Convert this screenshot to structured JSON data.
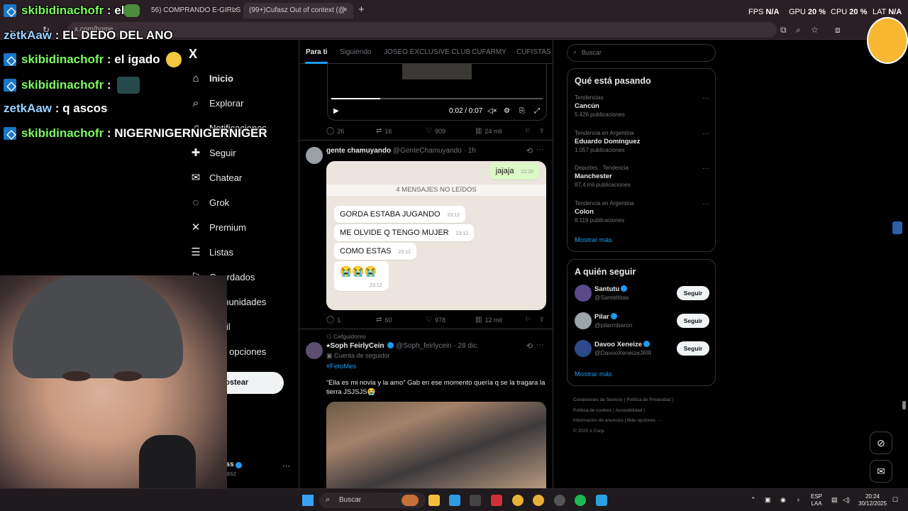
{
  "browser": {
    "tabs": [
      {
        "title": "56) COMPRANDO E-GIRLS",
        "close": "×"
      },
      {
        "title": "(99+)Cufasz Out of context (@",
        "close": "×"
      }
    ],
    "new_tab": "+",
    "url": "x.com/home",
    "perf": {
      "fps_label": "FPS",
      "fps_value": "N/A",
      "gpu_label": "GPU",
      "gpu_value": "20 %",
      "cpu_label": "CPU",
      "cpu_value": "20 %",
      "lat_label": "LAT",
      "lat_value": "N/A"
    }
  },
  "stream_chat": [
    {
      "user": "skibidinachofr",
      "color": "green",
      "text": ": el",
      "badge": true
    },
    {
      "user": "zetkAaw",
      "color": "blue",
      "text": ": EL DEDO DEL ANO",
      "badge": false
    },
    {
      "user": "skibidinachofr",
      "color": "green",
      "text": ": el igado",
      "badge": true
    },
    {
      "user": "skibidinachofr",
      "color": "green",
      "text": ":",
      "badge": true
    },
    {
      "user": "zetkAaw",
      "color": "blue",
      "text": ": q ascos",
      "badge": false
    },
    {
      "user": "skibidinachofr",
      "color": "green",
      "text": ": NIGERNIGERNIGERNIGER",
      "badge": true
    }
  ],
  "sidebar": {
    "logo": "X",
    "items": [
      {
        "label": "Inicio",
        "icon": "home-icon",
        "glyph": "⌂"
      },
      {
        "label": "Explorar",
        "icon": "search-icon",
        "glyph": "⌕"
      },
      {
        "label": "Notificaciones",
        "icon": "bell-icon",
        "glyph": "♫"
      },
      {
        "label": "Seguir",
        "icon": "follow-icon",
        "glyph": "✚"
      },
      {
        "label": "Chatear",
        "icon": "mail-icon",
        "glyph": "✉"
      },
      {
        "label": "Grok",
        "icon": "grok-icon",
        "glyph": "◌"
      },
      {
        "label": "Premium",
        "icon": "x-premium-icon",
        "glyph": "✕"
      },
      {
        "label": "Listas",
        "icon": "list-icon",
        "glyph": "☰"
      },
      {
        "label": "Guardados",
        "icon": "bookmark-icon",
        "glyph": "⚐"
      },
      {
        "label": "Comunidades",
        "icon": "communities-icon",
        "glyph": "⚇"
      },
      {
        "label": "Perfil",
        "icon": "profile-icon",
        "glyph": "⚲"
      },
      {
        "label": "Más opciones",
        "icon": "more-options-icon",
        "glyph": "⋯"
      }
    ],
    "post_button": "Postear",
    "account": {
      "name": "cufass",
      "handle": "@cufasz",
      "more": "···"
    }
  },
  "feed": {
    "tabs": [
      "Para ti",
      "Siguiendo",
      "JOSEO EXCLUSIVE CLUB",
      "CUFARMY",
      "CUFISTAS"
    ],
    "video": {
      "time": "0:02 / 0:07",
      "progress": 0.23
    },
    "tweet1_actions": {
      "replies": "26",
      "reposts": "16",
      "likes": "909",
      "views": "24 mil"
    },
    "tweet2": {
      "name": "gente chamuyando",
      "handle": "@GenteChamuyando",
      "time": "· 1h",
      "chat": {
        "outgoing": {
          "text": "jajaja",
          "time": "22:20"
        },
        "unread": "4 MENSAJES NO LEÍDOS",
        "messages": [
          {
            "text": "GORDA ESTABA JUGANDO",
            "time": "23:12"
          },
          {
            "text": "ME OLVIDE Q TENGO MUJER",
            "time": "23:12"
          },
          {
            "text": "COMO ESTAS",
            "time": "23:12"
          },
          {
            "text": "😭😭😭",
            "time": "23:12"
          }
        ]
      },
      "actions": {
        "replies": "1",
        "reposts": "60",
        "likes": "978",
        "views": "12 mil"
      }
    },
    "tweet3": {
      "context": "Cefguidores",
      "name": "⭑Soph FeirlyCein",
      "handle": "@Soph_feirlycein",
      "time": "· 28 dic.",
      "sub": "Cuenta de seguidor",
      "hashtag": "#FetoMes",
      "text": "“Ella es mi novia y la amo” Gab en ese momento quería q se la tragara la tierra JSJSJS😭"
    }
  },
  "right": {
    "search_placeholder": "Buscar",
    "trends_title": "Qué está pasando",
    "trends": [
      {
        "context": "Tendencias",
        "name": "Cancún",
        "count": "5.426 publicaciones"
      },
      {
        "context": "Tendencia en Argentina",
        "name": "Eduardo Domínguez",
        "count": "1.057 publicaciones"
      },
      {
        "context": "Deportes · Tendencia",
        "name": "Manchester",
        "count": "87,4 mil publicaciones"
      },
      {
        "context": "Tendencia en Argentina",
        "name": "Colon",
        "count": "8.119 publicaciones"
      }
    ],
    "trends_more": "Mostrar más",
    "follow_title": "A quién seguir",
    "follow": [
      {
        "name": "Santutu",
        "handle": "@Santeltitas",
        "button": "Seguir",
        "color": "#5a4a8a"
      },
      {
        "name": "Pilar",
        "handle": "@pilarmbaron",
        "button": "Seguir",
        "color": "#9aa6a8"
      },
      {
        "name": "Davoo Xeneize",
        "handle": "@DavooXeneizeJRR",
        "button": "Seguir",
        "color": "#2c4a8a"
      }
    ],
    "follow_more": "Mostrar más",
    "footer": [
      "Condiciones de Servicio",
      "|",
      "Política de Privacidad",
      "|",
      "Política de cookies",
      "|",
      "Accesibilidad",
      "|",
      "Información de anuncios",
      "|",
      "Más opciones ···",
      "© 2025 X Corp."
    ]
  },
  "taskbar": {
    "search": "Buscar",
    "lang": "ESP",
    "lang2": "LAA",
    "time": "20:24",
    "date": "30/12/2025"
  }
}
